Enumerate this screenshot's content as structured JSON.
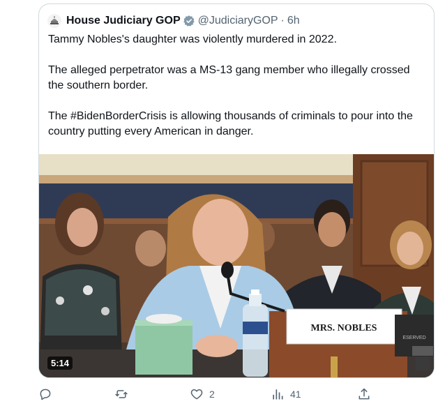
{
  "tweet": {
    "author_name": "House Judiciary GOP",
    "handle": "@JudiciaryGOP",
    "separator": "·",
    "time": "6h",
    "paragraphs": [
      "Tammy Nobles's daughter was violently murdered in 2022.",
      "The alleged perpetrator was a MS-13 gang member who illegally crossed the southern border.",
      "The #BidenBorderCrisis is allowing thousands of criminals to pour into the country putting every American in danger."
    ]
  },
  "media": {
    "duration": "5:14",
    "nameplate": "MRS. NOBLES",
    "card_text": "ESERVED"
  },
  "actions": {
    "reply_icon": "reply-icon",
    "retweet_icon": "retweet-icon",
    "like_icon": "heart-icon",
    "like_count": "2",
    "views_icon": "views-icon",
    "views_count": "41",
    "share_icon": "share-icon"
  },
  "colors": {
    "verified": "#829aab",
    "secondary_text": "#536471",
    "border": "#cfd9de"
  }
}
